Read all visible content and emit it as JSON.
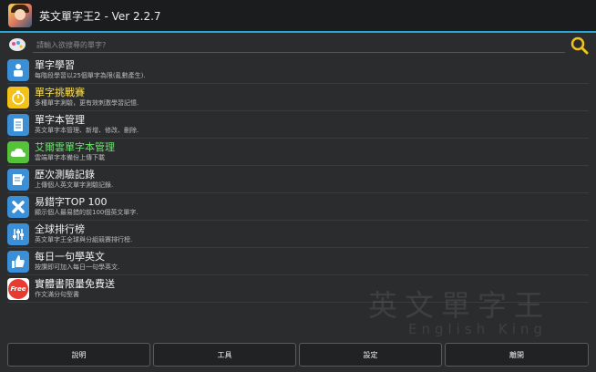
{
  "app": {
    "title": "英文單字王2 - Ver 2.2.7"
  },
  "search": {
    "placeholder": "請輸入欲搜尋的單字?"
  },
  "menu": [
    {
      "title": "單字學習",
      "subtitle": "每階段學習以25個單字為限(亂數產生).",
      "icon": "book-icon",
      "color": "#3b8fd6",
      "title_color": "white"
    },
    {
      "title": "單字挑戰賽",
      "subtitle": "多種單字測驗，更有效刺激學習記憶.",
      "icon": "stopwatch-icon",
      "color": "#f2c21a",
      "title_color": "yellow"
    },
    {
      "title": "單字本管理",
      "subtitle": "英文單字本管理、新增、修改、刪除.",
      "icon": "notebook-icon",
      "color": "#3b8fd6",
      "title_color": "white"
    },
    {
      "title": "艾爾雲單字本管理",
      "subtitle": "雲端單字本備份上傳下載",
      "icon": "cloud-icon",
      "color": "#56c23a",
      "title_color": "green"
    },
    {
      "title": "歷次測驗記錄",
      "subtitle": "上傳個人英文單字測驗記錄.",
      "icon": "edit-icon",
      "color": "#3b8fd6",
      "title_color": "white"
    },
    {
      "title": "易錯字TOP 100",
      "subtitle": "顯示個人最易錯的前100個英文單字.",
      "icon": "x-icon",
      "color": "#3b8fd6",
      "title_color": "white"
    },
    {
      "title": "全球排行榜",
      "subtitle": "英文單字王全球與分組競賽排行榜.",
      "icon": "sliders-icon",
      "color": "#3b8fd6",
      "title_color": "white"
    },
    {
      "title": "每日一句學英文",
      "subtitle": "按讚即可加入每日一句學英文.",
      "icon": "thumbs-up-icon",
      "color": "#3b8fd6",
      "title_color": "white"
    },
    {
      "title": "實體書限量免費送",
      "subtitle": "作文滿分句型書",
      "icon": "free-icon",
      "color": "#e83a2f",
      "title_color": "white",
      "icon_text": "Free"
    }
  ],
  "watermark": {
    "line1": "英文單字王",
    "line2": "English King"
  },
  "buttons": {
    "help": "說明",
    "tools": "工具",
    "settings": "設定",
    "about": "離開"
  },
  "colors": {
    "accent": "#2aa6d6",
    "background": "#2b2c2e"
  }
}
